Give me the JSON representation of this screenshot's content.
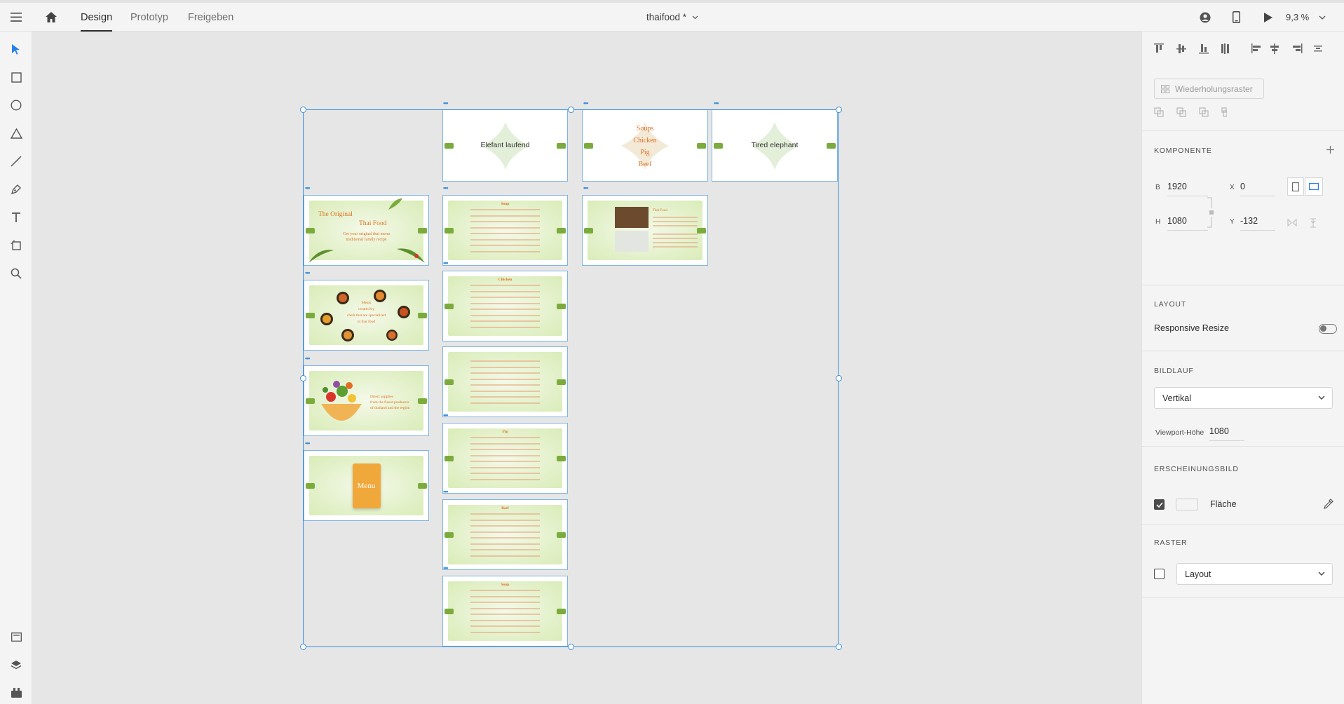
{
  "topbar": {
    "tabs": [
      "Design",
      "Prototyp",
      "Freigeben"
    ],
    "active_tab": "Design",
    "document_title": "thaifood *",
    "zoom_value": "9,3 %"
  },
  "icons": {
    "menu": "hamburger-menu-icon",
    "home": "home-icon",
    "user": "user-account-icon",
    "device": "mobile-preview-icon",
    "play": "play-icon"
  },
  "tools": [
    "select-tool",
    "rectangle-tool",
    "ellipse-tool",
    "triangle-tool",
    "line-tool",
    "pen-tool",
    "text-tool",
    "artboard-tool",
    "zoom-tool"
  ],
  "boards": {
    "elefant_laufend": "Elefant laufend",
    "tired_elephant": "Tired elephant",
    "categories": [
      "Soups",
      "Chicken",
      "Pig",
      "Beef"
    ],
    "title_line1": "The Original",
    "title_line2": "Thai Food",
    "subtitle_line1": "Get your original thai menu",
    "subtitle_line2": "traditional family recipe",
    "chef_line1": "Meals",
    "chef_line2": "created by",
    "chef_line3": "chefs that are specialized",
    "chef_line4": "in thai food",
    "supply_line1": "Direct supplies",
    "supply_line2": "from the finest producers",
    "supply_line3": "of thailand and the region",
    "menu_card": "Menu",
    "list_titles": [
      "Soup",
      "Chicken",
      "",
      "Pig",
      "Beef",
      "Soup"
    ],
    "contact_title": "Thai Food"
  },
  "panel": {
    "repeat_grid": "Wiederholungsraster",
    "component_title": "KOMPONENTE",
    "w_label": "B",
    "w_value": "1920",
    "x_label": "X",
    "x_value": "0",
    "h_label": "H",
    "h_value": "1080",
    "y_label": "Y",
    "y_value": "-132",
    "layout_title": "LAYOUT",
    "responsive_resize": "Responsive Resize",
    "responsive_on": false,
    "scroll_title": "BILDLAUF",
    "scroll_value": "Vertikal",
    "viewport_label": "Viewport-Höhe",
    "viewport_value": "1080",
    "appearance_title": "ERSCHEINUNGSBILD",
    "fill_label": "Fläche",
    "fill_checked": true,
    "fill_color": "#ffffff",
    "grid_title": "RASTER",
    "grid_value": "Layout",
    "grid_checked": false
  },
  "colors": {
    "accent": "#3b8fd9",
    "board_green": "#d9ecb8",
    "tag_green": "#7bab3c",
    "text_orange": "#e07020",
    "menu_card": "#f0a83b"
  }
}
